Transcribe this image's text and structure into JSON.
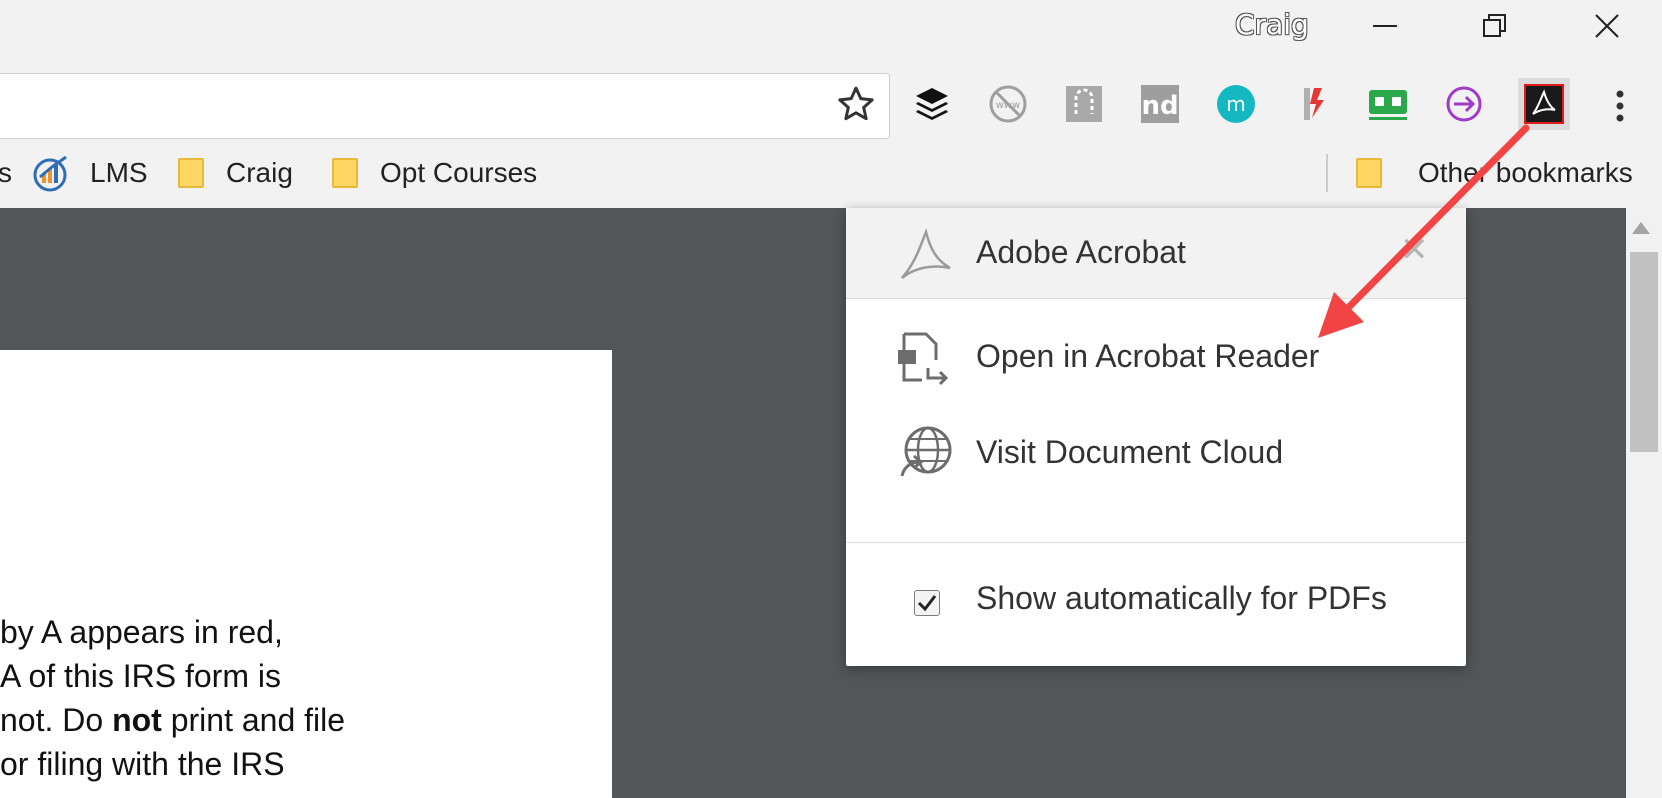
{
  "window": {
    "profile_name": "Craig",
    "minimize_glyph": "—",
    "restore_glyph": "❐",
    "close_glyph": "✕"
  },
  "toolbar": {
    "star_icon": "☆",
    "menu_icon": "⋮",
    "extensions": [
      {
        "name": "buffer-icon",
        "color": "#111111"
      },
      {
        "name": "no-www-icon",
        "color": "#9e9e9e"
      },
      {
        "name": "vertical-tabs-icon",
        "color": "#9e9e9e"
      },
      {
        "name": "nd-icon",
        "color": "#9e9e9e",
        "text": "nd"
      },
      {
        "name": "m-extension-icon",
        "color": "#14b8c0",
        "text": "m"
      },
      {
        "name": "lightning-extension-icon",
        "color": "#d9534f"
      },
      {
        "name": "cassette-extension-icon",
        "color": "#2aa84a"
      },
      {
        "name": "pdf-arrow-extension-icon",
        "color": "#a03bc8"
      },
      {
        "name": "adobe-acrobat-extension-icon",
        "color": "#1a1a1a"
      }
    ]
  },
  "bookmarks": {
    "items": [
      {
        "label": "s"
      },
      {
        "label": "LMS"
      },
      {
        "label": "Craig"
      },
      {
        "label": "Opt Courses"
      }
    ],
    "other_label": "Other bookmarks"
  },
  "pdf": {
    "lines": [
      "by A appears in red,",
      "A of this IRS form is",
      "not. Do ",
      "or filing with the IRS"
    ],
    "bold_word": "not",
    "line3_tail": " print and file"
  },
  "popup": {
    "title": "Adobe Acrobat",
    "close_glyph": "✕",
    "items": [
      {
        "label": "Open in Acrobat Reader"
      },
      {
        "label": "Visit Document Cloud"
      }
    ],
    "checkbox_label": "Show automatically for PDFs",
    "checkbox_checked": true
  },
  "colors": {
    "arrow": "#f24444",
    "content_bg": "#525659",
    "popup_bg": "#ffffff"
  }
}
